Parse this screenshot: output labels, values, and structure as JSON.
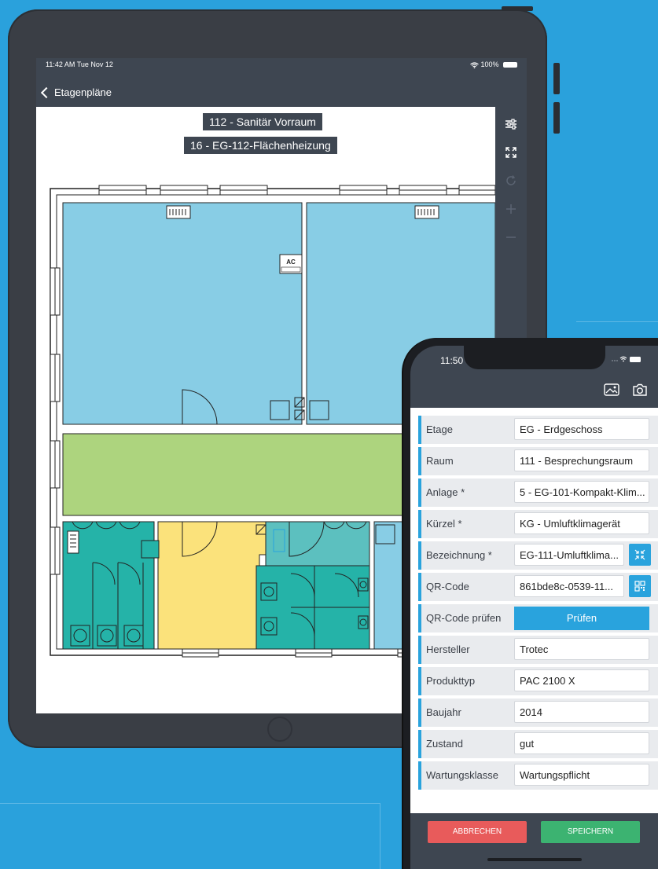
{
  "colors": {
    "background": "#2aa1dc",
    "device_frame": "#3a3e45",
    "header_bar": "#3e4651",
    "accent": "#29a3dd",
    "room_blue": "#88cde5",
    "room_green": "#add47e",
    "room_teal": "#25b3a8",
    "room_yellow": "#fbe27b",
    "cancel": "#e85b5b",
    "save": "#3cb371"
  },
  "tablet": {
    "status": {
      "time": "11:42 AM  Tue Nov 12",
      "battery": "100%"
    },
    "back_label": "Etagenpläne",
    "room_label": "112 - Sanitär Vorraum",
    "device_label": "16 - EG-112-Flächenheizung",
    "ac_label": "AC",
    "tools": [
      "sliders-icon",
      "fullscreen-icon",
      "refresh-icon",
      "zoom-in-icon",
      "zoom-out-icon"
    ]
  },
  "phone": {
    "time": "11:50",
    "header_icons": [
      "image-icon",
      "camera-icon"
    ],
    "fields": [
      {
        "label": "Etage",
        "value": "EG - Erdgeschoss"
      },
      {
        "label": "Raum",
        "value": "111 - Besprechungsraum"
      },
      {
        "label": "Anlage *",
        "value": "5 - EG-101-Kompakt-Klim..."
      },
      {
        "label": "Kürzel *",
        "value": "KG - Umluftklimagerät"
      },
      {
        "label": "Bezeichnung *",
        "value": "EG-111-Umluftklima..."
      },
      {
        "label": "QR-Code",
        "value": "861bde8c-0539-11..."
      },
      {
        "label": "QR-Code prüfen",
        "value": "Prüfen"
      },
      {
        "label": "Hersteller",
        "value": "Trotec"
      },
      {
        "label": "Produkttyp",
        "value": "PAC 2100 X"
      },
      {
        "label": "Baujahr",
        "value": "2014"
      },
      {
        "label": "Zustand",
        "value": "gut"
      },
      {
        "label": "Wartungsklasse",
        "value": "Wartungspflicht"
      }
    ],
    "cancel_label": "ABBRECHEN",
    "save_label": "SPEICHERN"
  }
}
